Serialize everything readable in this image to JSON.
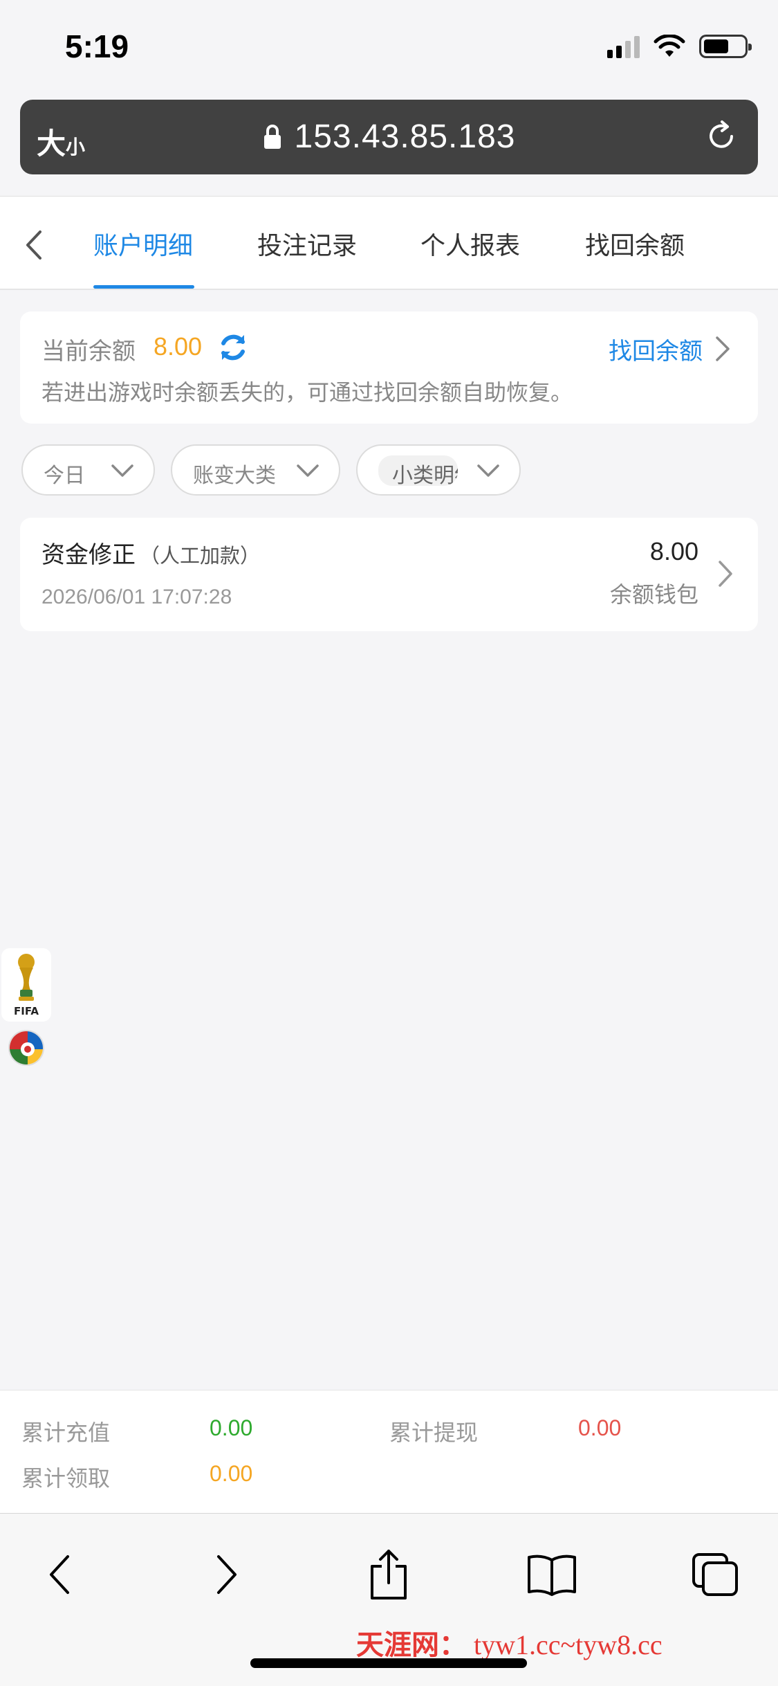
{
  "status_bar": {
    "time": "5:19"
  },
  "address_bar": {
    "text_size_big": "大",
    "text_size_small": "小",
    "url": "153.43.85.183"
  },
  "tabs": [
    {
      "label": "账户明细",
      "active": true
    },
    {
      "label": "投注记录",
      "active": false
    },
    {
      "label": "个人报表",
      "active": false
    },
    {
      "label": "找回余额",
      "active": false
    }
  ],
  "balance": {
    "label": "当前余额",
    "value": "8.00",
    "recover_label": "找回余额",
    "hint": "若进出游戏时余额丢失的，可通过找回余额自助恢复。"
  },
  "filters": [
    {
      "label": "今日"
    },
    {
      "label": "账变大类"
    },
    {
      "label": "小类明细"
    }
  ],
  "records": [
    {
      "title": "资金修正",
      "subtitle": "（人工加款）",
      "date": "2026/06/01 17:07:28",
      "amount": "8.00",
      "wallet": "余额钱包"
    }
  ],
  "floating": {
    "fifa_text": "FIFA"
  },
  "summary": {
    "recharge_label": "累计充值",
    "recharge_value": "0.00",
    "withdraw_label": "累计提现",
    "withdraw_value": "0.00",
    "claim_label": "累计领取",
    "claim_value": "0.00"
  },
  "watermark": {
    "site": "天涯网：",
    "urls": "tyw1.cc~tyw8.cc"
  },
  "colors": {
    "accent": "#1e88e5",
    "balance": "#f5a623",
    "recharge": "#2eaa2e",
    "withdraw": "#e5534b",
    "claim": "#f5a623"
  }
}
